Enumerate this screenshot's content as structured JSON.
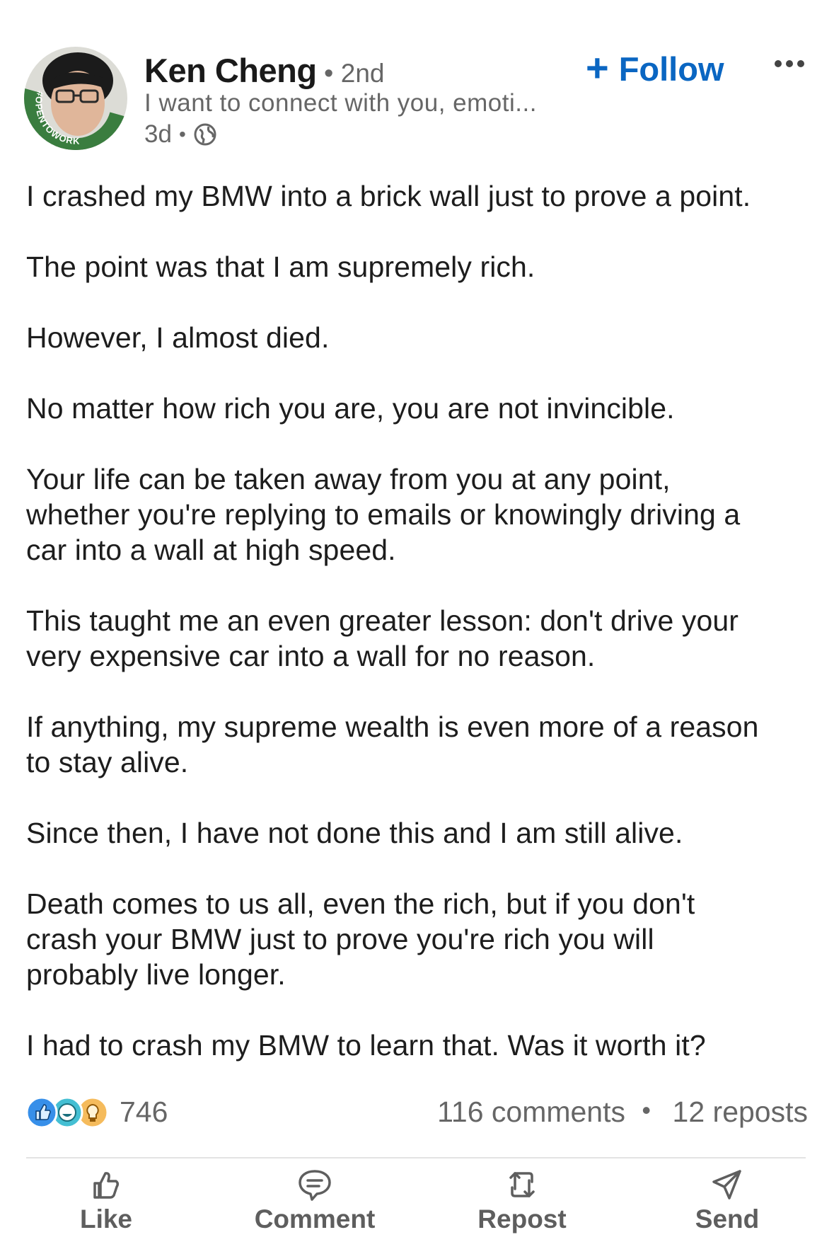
{
  "post": {
    "author": {
      "name": "Ken Cheng",
      "degree": "2nd",
      "separator": "•",
      "headline": "I want to connect with you, emoti...",
      "time": "3d",
      "badge": "#OPENTOWORK",
      "visibility_icon": "globe-icon"
    },
    "follow_label": "Follow",
    "paragraphs": [
      [
        "I crashed my BMW into a brick wall just to prove a point."
      ],
      [
        "The point was that I am supremely rich."
      ],
      [
        "However, I almost died."
      ],
      [
        "No matter how rich you are, you are not invincible."
      ],
      [
        "Your life can be taken away from you at any point,",
        "whether you're replying to emails or knowingly driving a",
        "car into a wall at high speed."
      ],
      [
        "This taught me an even greater lesson: don't drive your",
        "very expensive car into a wall for no reason."
      ],
      [
        "If anything, my supreme wealth is even more of a reason",
        "to stay alive."
      ],
      [
        "Since then, I have not done this and I am still alive."
      ],
      [
        "Death comes to us all, even the rich, but if you don't",
        "crash your BMW just to prove you're rich you will",
        "probably live longer."
      ],
      [
        "I had to crash my BMW to learn that. Was it worth it?"
      ]
    ],
    "social": {
      "reaction_count": "746",
      "reaction_icons": [
        "like-icon",
        "funny-icon",
        "insightful-icon"
      ],
      "comments": "116 comments",
      "separator": "•",
      "reposts": "12 reposts"
    },
    "actions": [
      {
        "label": "Like",
        "icon": "thumbs-up-icon"
      },
      {
        "label": "Comment",
        "icon": "comment-icon"
      },
      {
        "label": "Repost",
        "icon": "repost-icon"
      },
      {
        "label": "Send",
        "icon": "send-icon"
      }
    ]
  },
  "colors": {
    "accent": "#0a66c2",
    "open_to_work_ring": "#3a7d3f",
    "muted_text": "#666666",
    "body_text": "#1d1d1d"
  }
}
